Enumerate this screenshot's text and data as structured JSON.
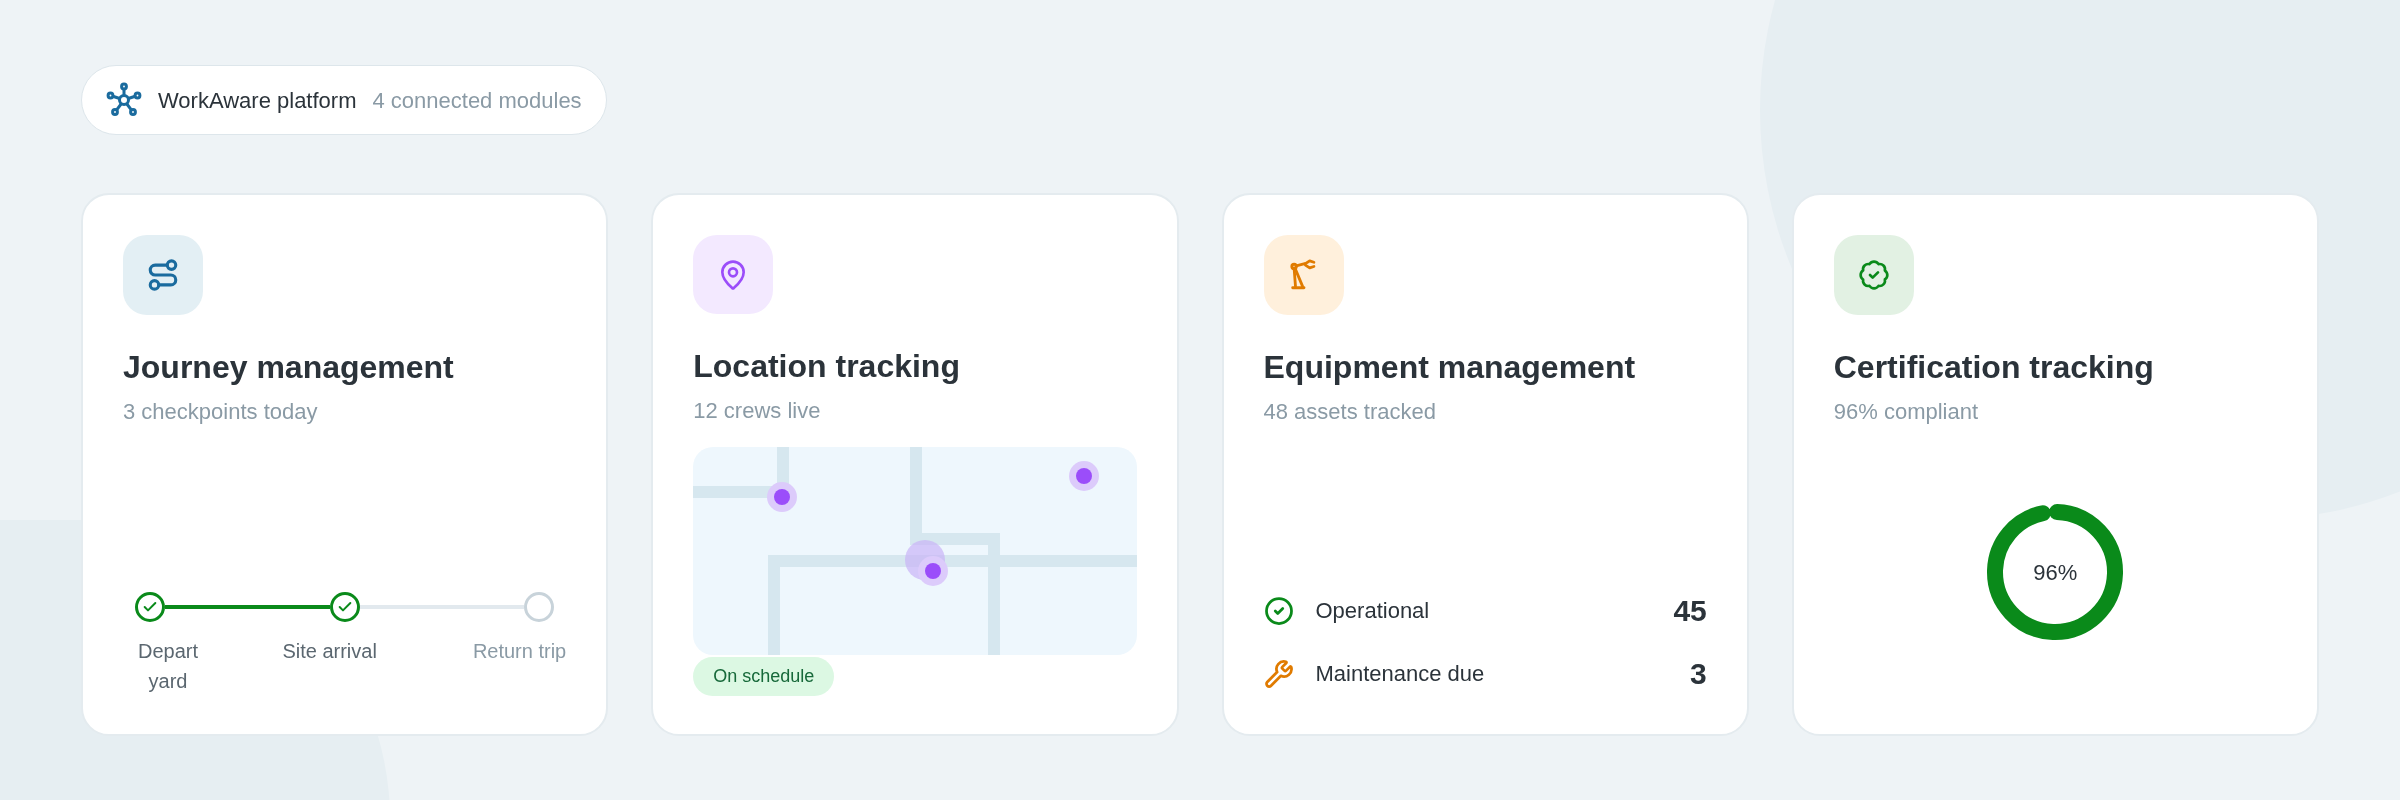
{
  "platform": {
    "title": "WorkAware platform",
    "subtitle": "4 connected modules"
  },
  "cards": [
    {
      "kind": "journey",
      "title": "Journey management",
      "subtitle": "3 checkpoints today",
      "steps": [
        {
          "label": "Depart yard",
          "checked": true
        },
        {
          "label": "Site arrival",
          "checked": true
        },
        {
          "label": "Return trip",
          "checked": false
        }
      ]
    },
    {
      "kind": "location",
      "title": "Location tracking",
      "subtitle": "12 crews live",
      "badge": "On schedule"
    },
    {
      "kind": "equipment",
      "title": "Equipment management",
      "subtitle": "48 assets tracked",
      "rows": [
        {
          "kind": "ok",
          "label": "Operational",
          "value": "45"
        },
        {
          "kind": "maintenance",
          "label": "Maintenance due",
          "value": "3"
        }
      ]
    },
    {
      "kind": "certification",
      "title": "Certification tracking",
      "subtitle": "96% compliant",
      "gauge": {
        "level": 0.96,
        "label": "96%"
      }
    }
  ]
}
